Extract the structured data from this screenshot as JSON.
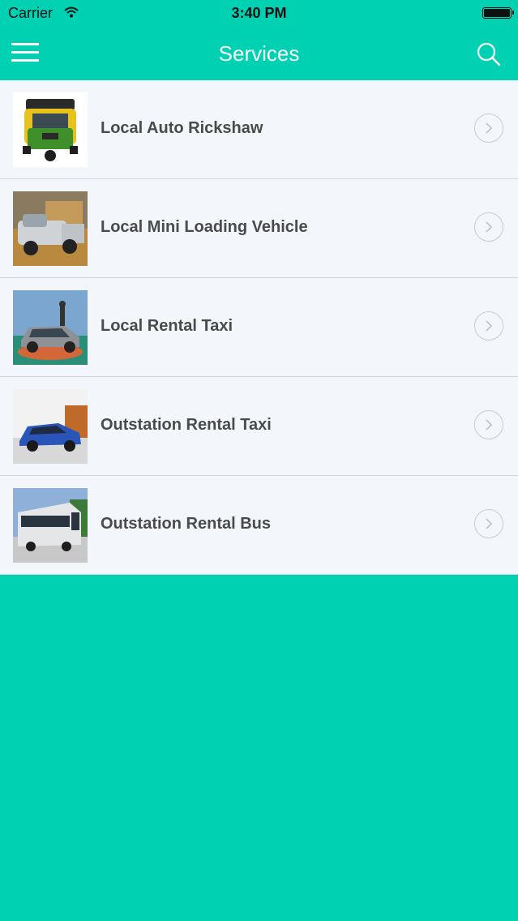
{
  "status_bar": {
    "carrier": "Carrier",
    "time": "3:40 PM"
  },
  "nav": {
    "title": "Services"
  },
  "services": [
    {
      "label": "Local Auto Rickshaw",
      "icon": "auto-rickshaw"
    },
    {
      "label": "Local Mini Loading Vehicle",
      "icon": "pickup-truck"
    },
    {
      "label": "Local Rental Taxi",
      "icon": "sedan-car"
    },
    {
      "label": "Outstation Rental Taxi",
      "icon": "blue-sedan-car"
    },
    {
      "label": "Outstation Rental Bus",
      "icon": "bus"
    }
  ],
  "colors": {
    "accent": "#00d1b2",
    "list_bg": "#f3f6fa",
    "text": "#4a4a4a"
  }
}
